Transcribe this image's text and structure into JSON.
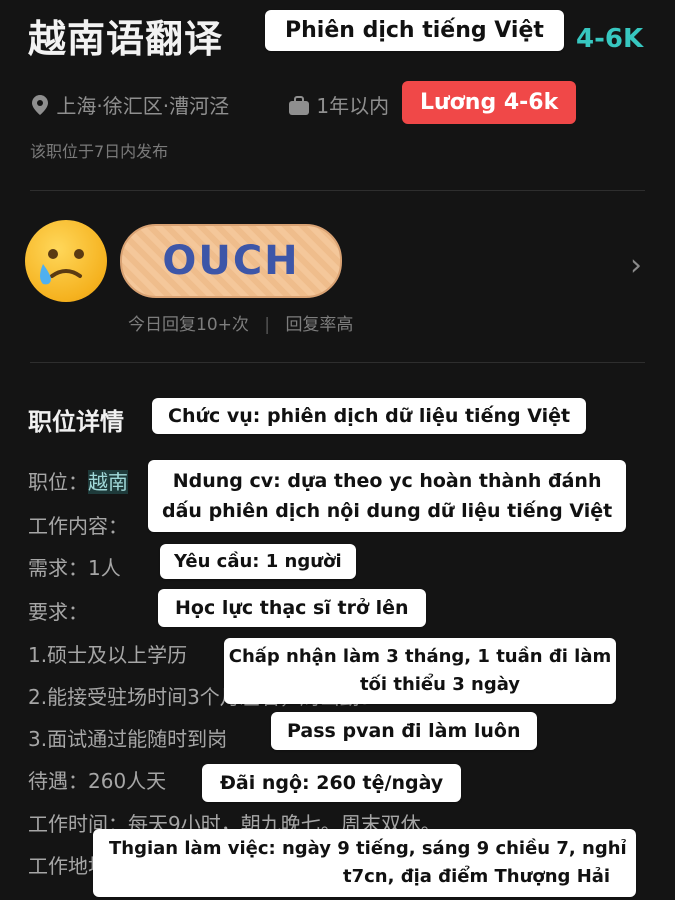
{
  "job": {
    "title": "越南语翻译",
    "title_overlay": "Phiên dịch tiếng Việt",
    "salary": "4-6K",
    "location": "上海·徐汇区·漕河泾",
    "experience": "1年以内",
    "salary_overlay": "Lương 4-6k",
    "posted": "该职位于7日内发布"
  },
  "recruiter": {
    "sticker_text": "OUCH",
    "reply_count": "今日回复10+次",
    "separator": "|",
    "reply_rate": "回复率高"
  },
  "details": {
    "heading": "职位详情",
    "heading_overlay": "Chức vụ: phiên dịch dữ liệu tiếng Việt",
    "lines": {
      "position_label": "职位：",
      "position_value": "越南",
      "content_label": "工作内容：",
      "content_overlay_1": "Ndung cv: dựa theo yc hoàn thành đánh",
      "content_overlay_2": "dấu phiên dịch nội dung dữ liệu tiếng Việt",
      "demand": "需求：1人",
      "demand_overlay": "Yêu cầu: 1 người",
      "requirement": "要求：",
      "requirement_overlay": "Học lực thạc sĩ trở lên",
      "req1": "1.硕士及以上学历",
      "req1_overlay_1": "Chấp nhận làm 3 tháng, 1 tuần đi làm",
      "req1_overlay_2": "tối thiểu 3 ngày",
      "req2": "2.能接受驻场时间3个月左右，周出勤3",
      "req3": "3.面试通过能随时到岗",
      "req3_overlay": "Pass pvan đi làm luôn",
      "pay": "待遇：260人天",
      "pay_overlay": "Đãi ngộ: 260 tệ/ngày",
      "hours": "工作时间：每天9小时，朝九晚七。周末双休。",
      "place": "工作地址：上海市漕河泾",
      "hours_overlay_1": "Thgian làm việc: ngày 9 tiếng, sáng 9 chiều 7, nghỉ",
      "hours_overlay_2": "t7cn, địa điểm Thượng Hải"
    }
  },
  "colors": {
    "background": "#141414",
    "salary": "#37c7c0",
    "red_badge": "#f04848"
  }
}
